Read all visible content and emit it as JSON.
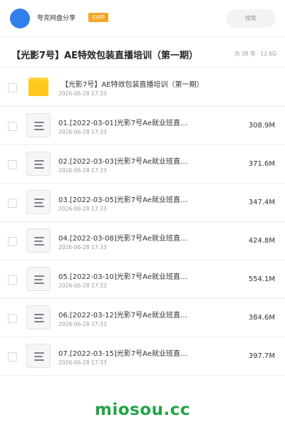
{
  "header": {
    "share_title": "夸克网盘分享",
    "badge": "SVIP",
    "search_placeholder": "搜索",
    "colors": {
      "avatar": "#2f80ed",
      "badge": "#f5a623"
    }
  },
  "folder": {
    "title": "【光影7号】AE特效包装直播培训（第一期）",
    "summary": "共 38 项 · 12.6G"
  },
  "files": [
    {
      "type": "folder",
      "name": "【光影7号】AE特效包装直播培训（第一期）",
      "date": "2026-06-28 17:33",
      "size": "",
      "icon": "folder-icon"
    },
    {
      "type": "file",
      "name": "01.[2022-03-01]光影7号Ae就业班直…",
      "date": "2026-06-28 17:33",
      "size": "308.9M",
      "icon": "document-icon"
    },
    {
      "type": "file",
      "name": "02.[2022-03-03]光影7号Ae就业班直…",
      "date": "2026-06-28 17:33",
      "size": "371.6M",
      "icon": "document-icon"
    },
    {
      "type": "file",
      "name": "03.[2022-03-05]光影7号Ae就业班直…",
      "date": "2026-06-28 17:33",
      "size": "347.4M",
      "icon": "document-icon"
    },
    {
      "type": "file",
      "name": "04.[2022-03-08]光影7号Ae就业班直…",
      "date": "2026-06-28 17:33",
      "size": "424.8M",
      "icon": "document-icon"
    },
    {
      "type": "file",
      "name": "05.[2022-03-10]光影7号Ae就业班直…",
      "date": "2026-06-28 17:33",
      "size": "554.1M",
      "icon": "document-icon"
    },
    {
      "type": "file",
      "name": "06.[2022-03-12]光影7号Ae就业班直…",
      "date": "2026-06-28 17:33",
      "size": "384.6M",
      "icon": "document-icon"
    },
    {
      "type": "file",
      "name": "07.[2022-03-15]光影7号Ae就业班直…",
      "date": "2026-06-28 17:33",
      "size": "397.7M",
      "icon": "document-icon"
    }
  ],
  "watermark": "miosou.cc"
}
